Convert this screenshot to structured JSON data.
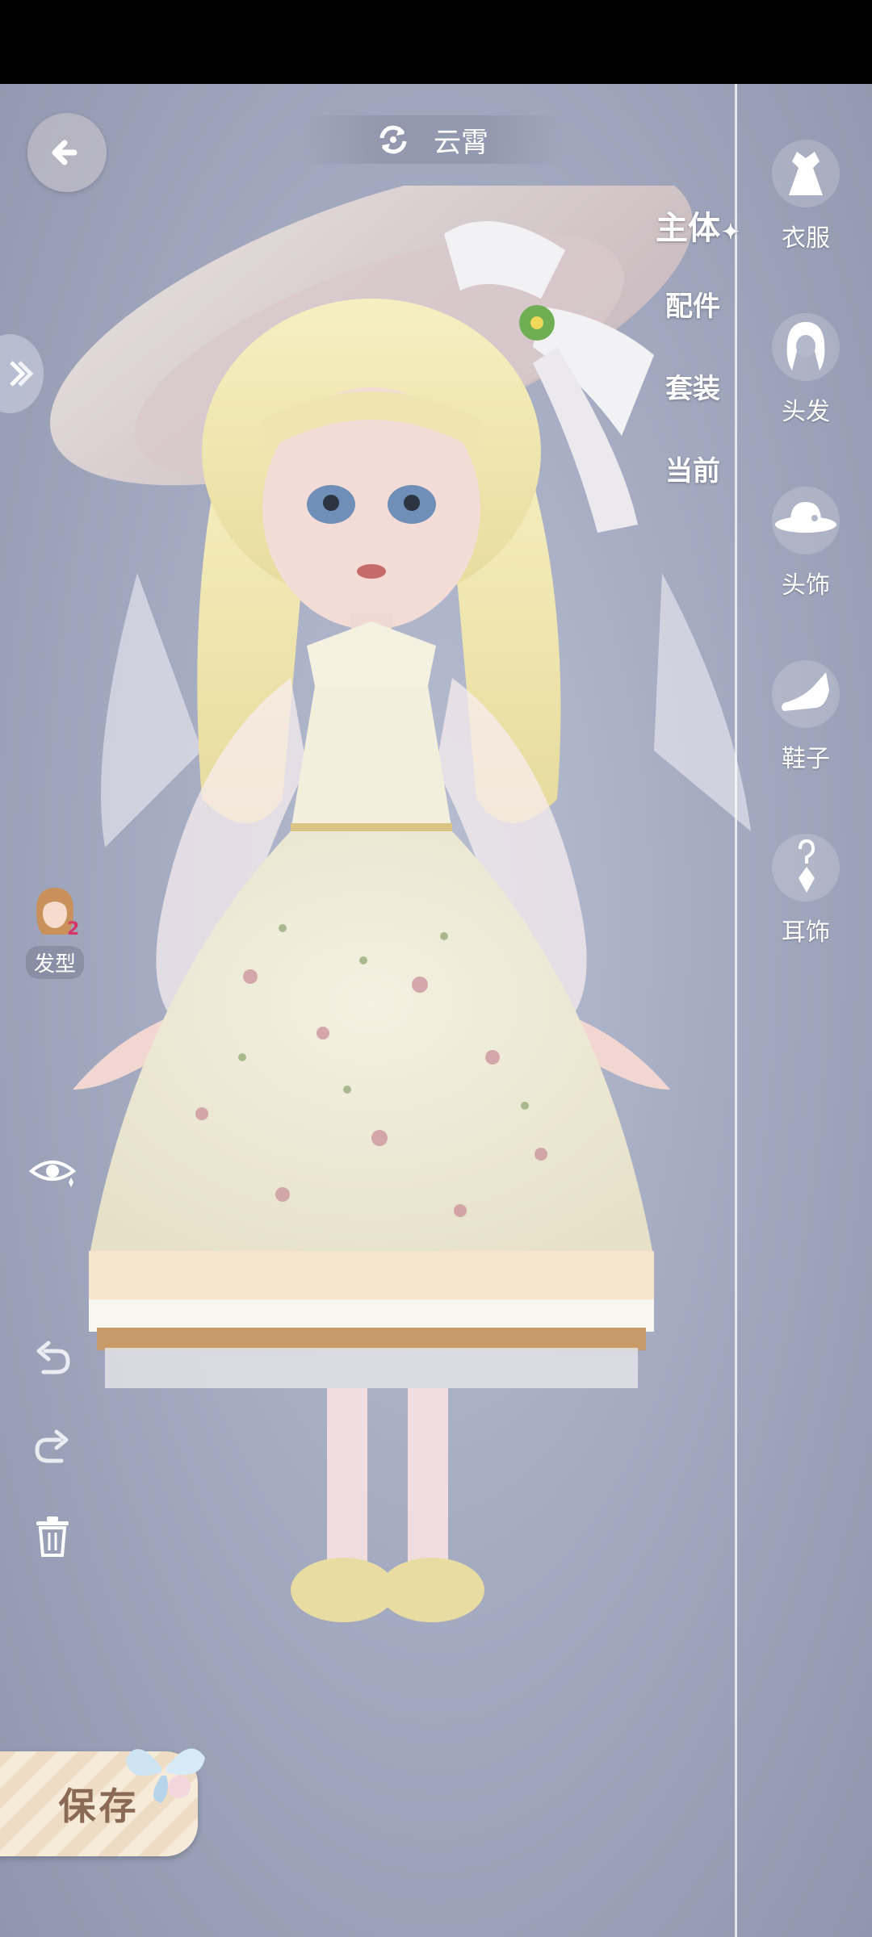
{
  "outfit_name": "云霄",
  "subtabs": [
    {
      "label": "主体",
      "active": true
    },
    {
      "label": "配件",
      "active": false
    },
    {
      "label": "套装",
      "active": false
    },
    {
      "label": "当前",
      "active": false
    }
  ],
  "categories": [
    {
      "label": "衣服",
      "icon": "dress-icon"
    },
    {
      "label": "头发",
      "icon": "hair-icon"
    },
    {
      "label": "头饰",
      "icon": "hat-icon"
    },
    {
      "label": "鞋子",
      "icon": "shoe-icon"
    },
    {
      "label": "耳饰",
      "icon": "earring-icon"
    }
  ],
  "hairstyle": {
    "label": "发型",
    "badge": "2"
  },
  "save_label": "保存",
  "colors": {
    "accent": "#8a6a54",
    "background": "#a5abc1"
  }
}
